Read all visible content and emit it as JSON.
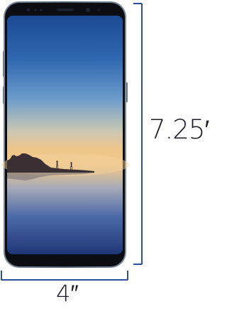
{
  "dimensions": {
    "height_label": "7.25′",
    "width_label": "4″"
  },
  "colors": {
    "dimension_line": "#2c4f9e",
    "phone_frame": "#5c6878",
    "screen_border": "#0b0d12",
    "sky_top": "#1f4e98",
    "sky_mid": "#5f93c8",
    "horizon": "#ecc488",
    "reflection_bottom": "#243a78"
  }
}
